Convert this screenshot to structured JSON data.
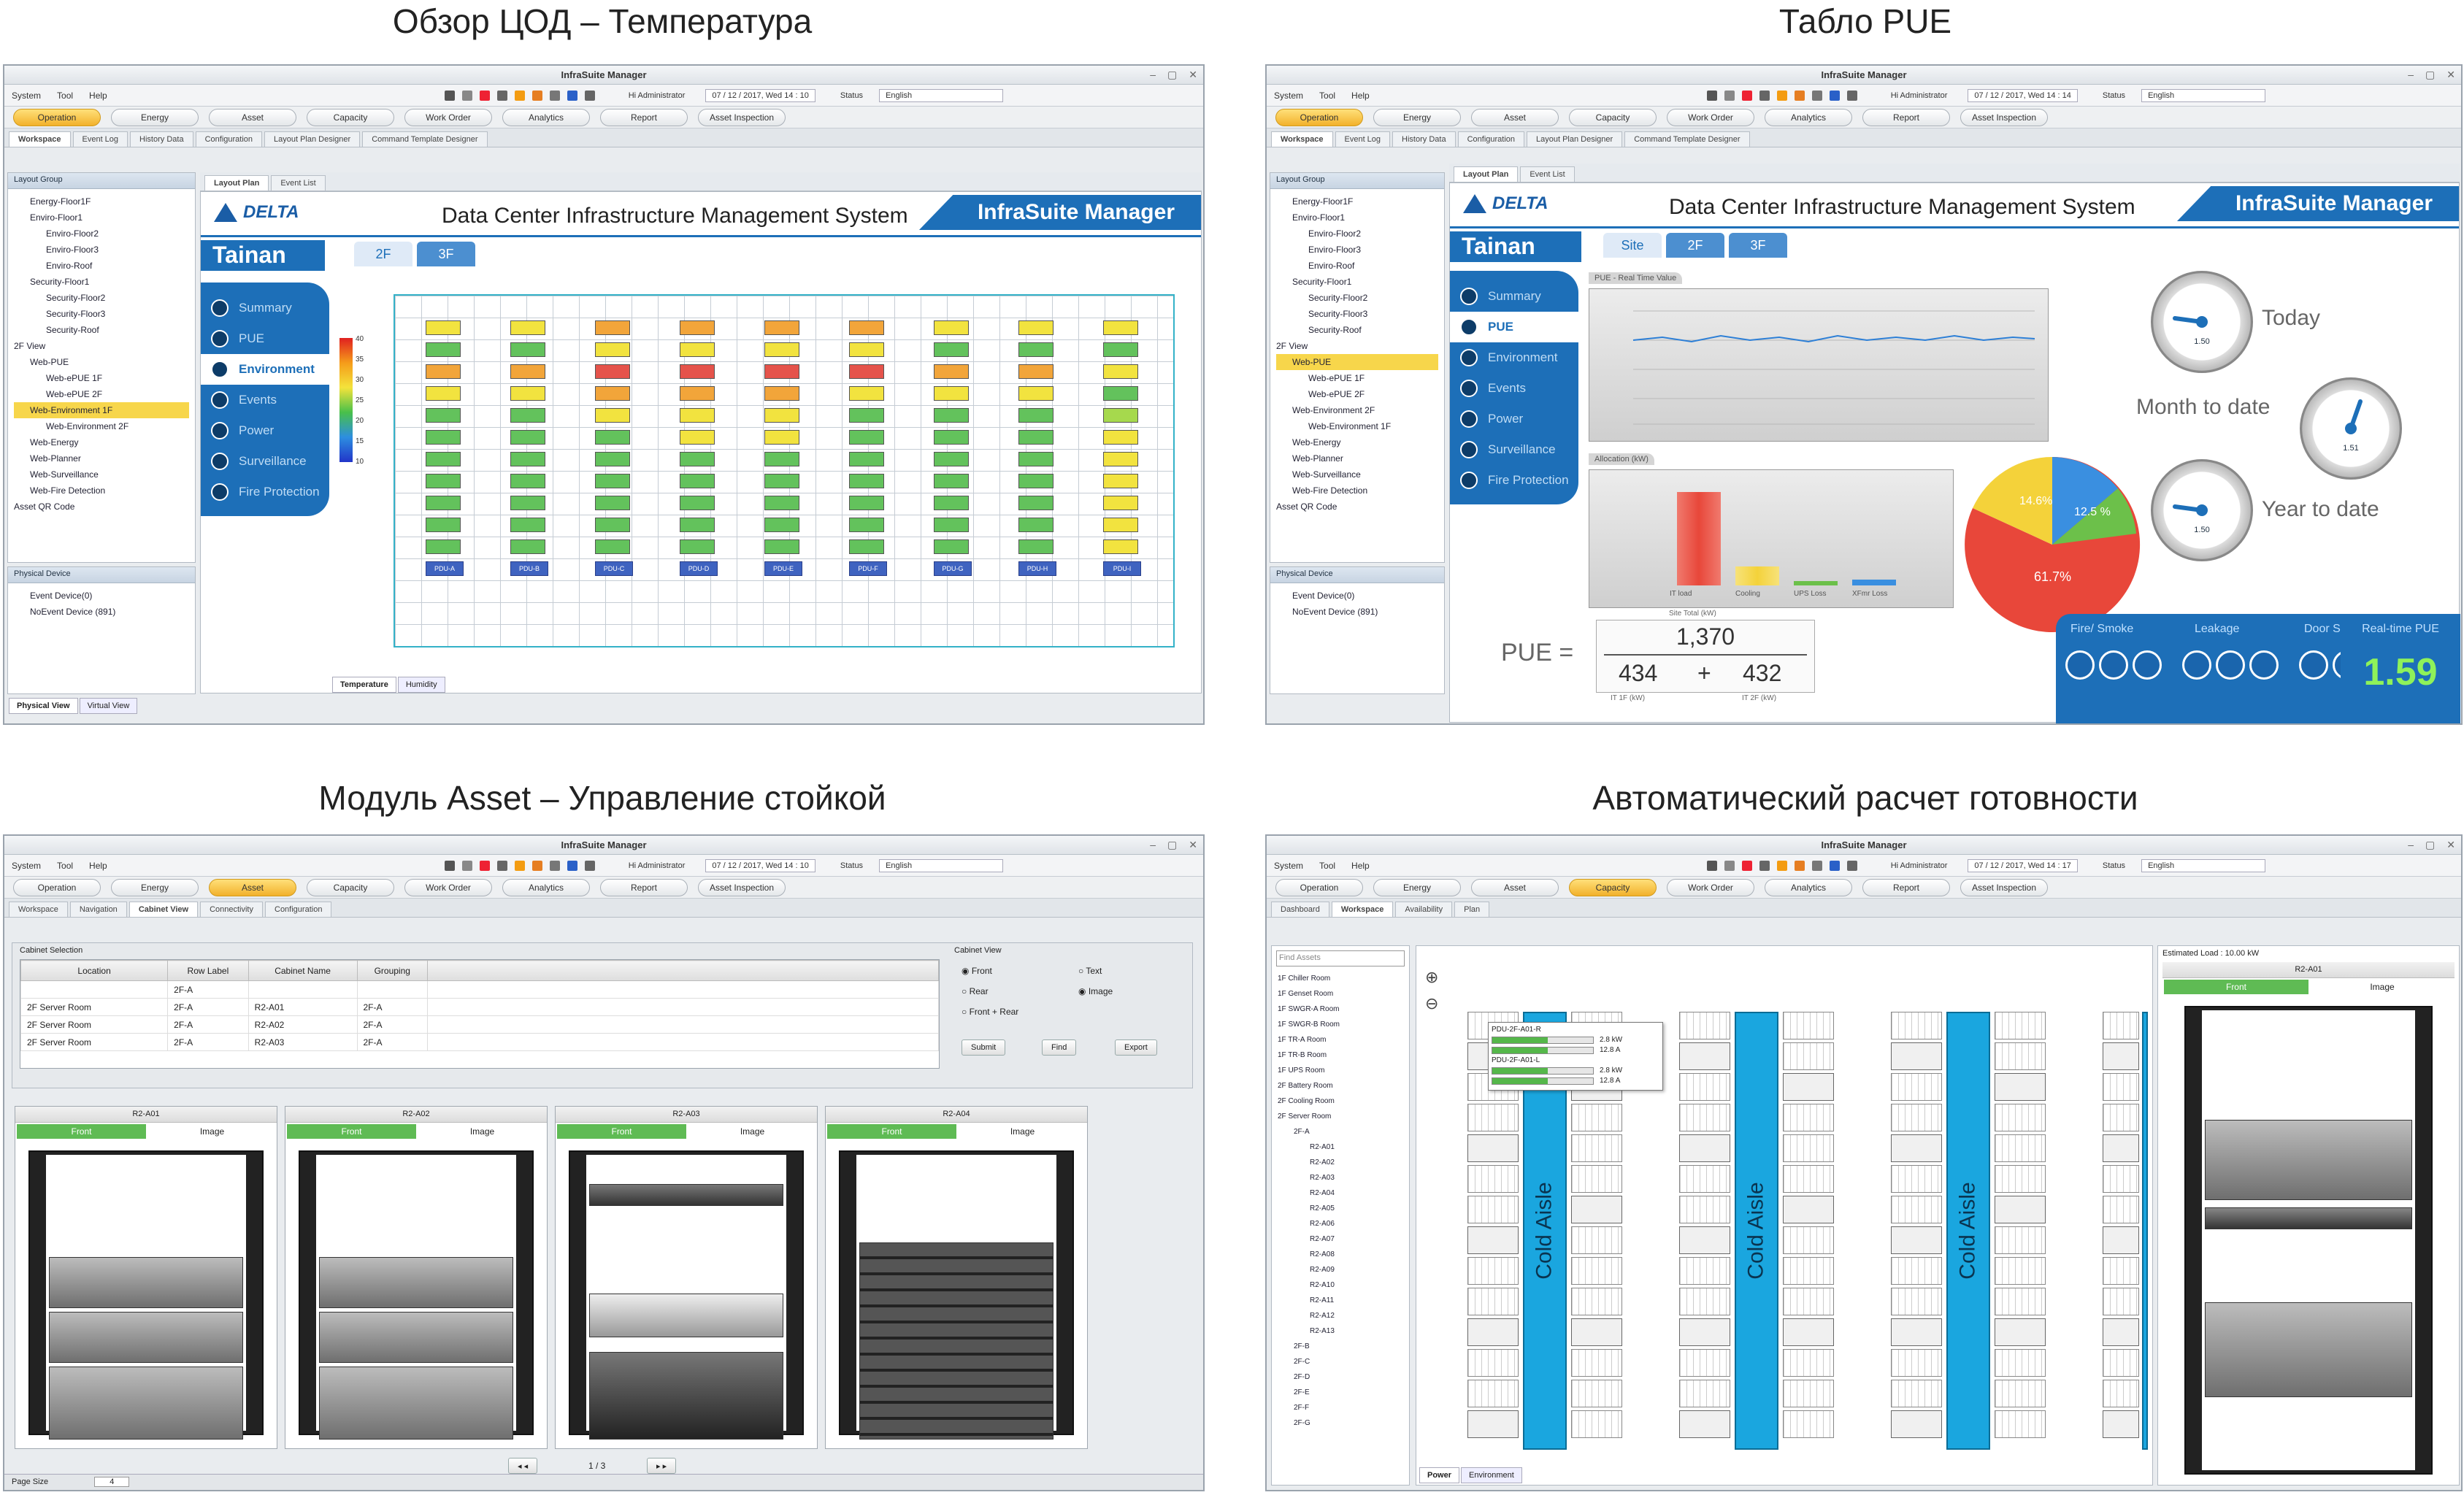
{
  "captions": {
    "q1": "Обзор ЦОД – Температура",
    "q2": "Табло PUE",
    "q3": "Модуль Asset – Управление стойкой",
    "q4": "Автоматический расчет готовности"
  },
  "app": {
    "window_title": "InfraSuite Manager",
    "menu": [
      "System",
      "Tool",
      "Help"
    ],
    "admin_label": "Hi Administrator",
    "status_label": "Status",
    "language": "English",
    "modules": [
      "Operation",
      "Energy",
      "Asset",
      "Capacity",
      "Work Order",
      "Analytics",
      "Report",
      "Asset Inspection"
    ],
    "system_title": "Data Center Infrastructure Management System",
    "brand_name": "InfraSuite Manager",
    "logo_text": "DELTA",
    "site_name": "Tainan",
    "colors": {
      "primary": "#1d6fb8",
      "active_module": "#f2b12b",
      "cold_aisle": "#1aa6df",
      "front_tab": "#5fbb54"
    }
  },
  "s1": {
    "date": "07 / 12 / 2017, Wed  14 : 10",
    "subtabs": [
      "Workspace",
      "Event Log",
      "History Data",
      "Configuration",
      "Layout Plan Designer",
      "Command Template Designer"
    ],
    "layout_tabs": [
      "Layout Plan",
      "Event List"
    ],
    "layout_group_title": "Layout Group",
    "tree": [
      "Energy-Floor1F",
      "Enviro-Floor1",
      "Enviro-Floor2",
      "Enviro-Floor3",
      "Enviro-Roof",
      "Security-Floor1",
      "Security-Floor2",
      "Security-Floor3",
      "Security-Roof",
      "2F View",
      "Web-PUE",
      "Web-ePUE 1F",
      "Web-ePUE 2F",
      "Web-Environment 1F",
      "Web-Environment 2F",
      "Web-Energy",
      "Web-Planner",
      "Web-Surveillance",
      "Web-Fire Detection",
      "Asset QR Code"
    ],
    "physical_title": "Physical Device",
    "physical": [
      "Event Device(0)",
      "NoEvent Device (891)"
    ],
    "floor_tabs": [
      "2F",
      "3F"
    ],
    "sidenav": [
      "Summary",
      "PUE",
      "Environment",
      "Events",
      "Power",
      "Surveillance",
      "Fire Protection"
    ],
    "legend_ticks": [
      "40",
      "35",
      "30",
      "25",
      "20",
      "15",
      "10"
    ],
    "pdu_labels": [
      "PDU-A",
      "PDU-B",
      "PDU-C",
      "PDU-D",
      "PDU-E",
      "PDU-F",
      "PDU-G",
      "PDU-H",
      "PDU-I"
    ],
    "bottom_tabs": [
      "Temperature",
      "Humidity"
    ],
    "bottom_panel_tabs": [
      "Physical View",
      "Virtual View"
    ]
  },
  "s2": {
    "date": "07 / 12 / 2017, Wed  14 : 14",
    "subtabs": [
      "Workspace",
      "Event Log",
      "History Data",
      "Configuration",
      "Layout Plan Designer",
      "Command Template Designer"
    ],
    "layout_tabs": [
      "Layout Plan",
      "Event List"
    ],
    "layout_group_title": "Layout Group",
    "tree": [
      "Energy-Floor1F",
      "Enviro-Floor1",
      "Enviro-Floor2",
      "Enviro-Floor3",
      "Enviro-Roof",
      "Security-Floor1",
      "Security-Floor2",
      "Security-Floor3",
      "Security-Roof",
      "2F View",
      "Web-PUE",
      "Web-ePUE 1F",
      "Web-ePUE 2F",
      "Web-Environment 2F",
      "Web-Environment 1F",
      "Web-Energy",
      "Web-Planner",
      "Web-Surveillance",
      "Web-Fire Detection",
      "Asset QR Code"
    ],
    "physical_title": "Physical Device",
    "physical": [
      "Event Device(0)",
      "NoEvent Device (891)"
    ],
    "floor_tabs": [
      "Site",
      "2F",
      "3F"
    ],
    "sidenav": [
      "Summary",
      "PUE",
      "Environment",
      "Events",
      "Power",
      "Surveillance",
      "Fire Protection"
    ],
    "rt_label": "PUE - Real Time Value",
    "alloc_label": "Allocation (kW)",
    "alloc_cats": [
      "IT load",
      "Cooling",
      "UPS Loss",
      "XFmr Loss"
    ],
    "alloc_colors": [
      "#e8473a",
      "#f4d23a",
      "#6cc04a",
      "#3a8fe0"
    ],
    "pie_labels": [
      "14.6%",
      "12.5 %",
      "61.7%"
    ],
    "gauge_labels": [
      "Today",
      "Month to date",
      "Year to date"
    ],
    "gauge_values": [
      "1.50",
      "1.51",
      "1.50"
    ],
    "pue_prefix": "PUE =",
    "pue_numerator": "1,370",
    "pue_left": "434",
    "pue_plus": "+",
    "pue_right": "432",
    "site_total": "Site Total (kW)",
    "it_kw": "IT 1F (kW)",
    "it2_kw": "IT 2F (kW)",
    "status_titles": [
      "Fire/ Smoke",
      "Leakage",
      "Door Status"
    ],
    "realtime_title": "Real-time PUE",
    "realtime_value": "1.59"
  },
  "s3": {
    "date": "07 / 12 / 2017, Wed  14 : 10",
    "subtabs": [
      "Workspace",
      "Navigation",
      "Cabinet View",
      "Connectivity",
      "Configuration"
    ],
    "selection_title": "Cabinet Selection",
    "columns": [
      "Location",
      "Row Label",
      "Cabinet Name",
      "Grouping"
    ],
    "filter_row": "2F-A",
    "rows": [
      [
        "2F Server Room",
        "2F-A",
        "R2-A01",
        "2F-A"
      ],
      [
        "2F Server Room",
        "2F-A",
        "R2-A02",
        "2F-A"
      ],
      [
        "2F Server Room",
        "2F-A",
        "R2-A03",
        "2F-A"
      ]
    ],
    "view_title": "Cabinet View",
    "view_opts": [
      "Front",
      "Rear",
      "Front + Rear",
      "Text",
      "Image"
    ],
    "buttons": [
      "Submit",
      "Find",
      "Export"
    ],
    "cabinets": [
      "R2-A01",
      "R2-A02",
      "R2-A03",
      "R2-A04"
    ],
    "front": "Front",
    "image": "Image",
    "pager": "1 / 3",
    "page_size_label": "Page Size",
    "page_size": "4"
  },
  "s4": {
    "date": "07 / 12 / 2017, Wed  14 : 17",
    "subtabs": [
      "Dashboard",
      "Workspace",
      "Availability",
      "Plan"
    ],
    "find_placeholder": "Find Assets",
    "tree": [
      "1F Chiller Room",
      "1F Genset Room",
      "1F SWGR-A Room",
      "1F SWGR-B Room",
      "1F TR-A Room",
      "1F TR-B Room",
      "1F UPS Room",
      "2F Battery Room",
      "2F Cooling Room",
      "2F Server Room",
      "2F-A",
      "R2-A01",
      "R2-A02",
      "R2-A03",
      "R2-A04",
      "R2-A05",
      "R2-A06",
      "R2-A07",
      "R2-A08",
      "R2-A09",
      "R2-A10",
      "R2-A11",
      "R2-A12",
      "R2-A13",
      "2F-B",
      "2F-C",
      "2F-D",
      "2F-E",
      "2F-F",
      "2F-G"
    ],
    "cold_aisle": "Cold Aisle",
    "tooltip": [
      {
        "name": "PDU-2F-A01-R",
        "kw": "2.8 kW",
        "amp": "12.8 A",
        "fill": 0.55
      },
      {
        "name": "PDU-2F-A01-L",
        "kw": "2.8 kW",
        "amp": "12.8 A",
        "fill": 0.55
      }
    ],
    "est_load": "Estimated Load : 10.00 kW",
    "cab_name": "R2-A01",
    "front": "Front",
    "image": "Image",
    "bottom_tabs": [
      "Power",
      "Environment"
    ]
  }
}
